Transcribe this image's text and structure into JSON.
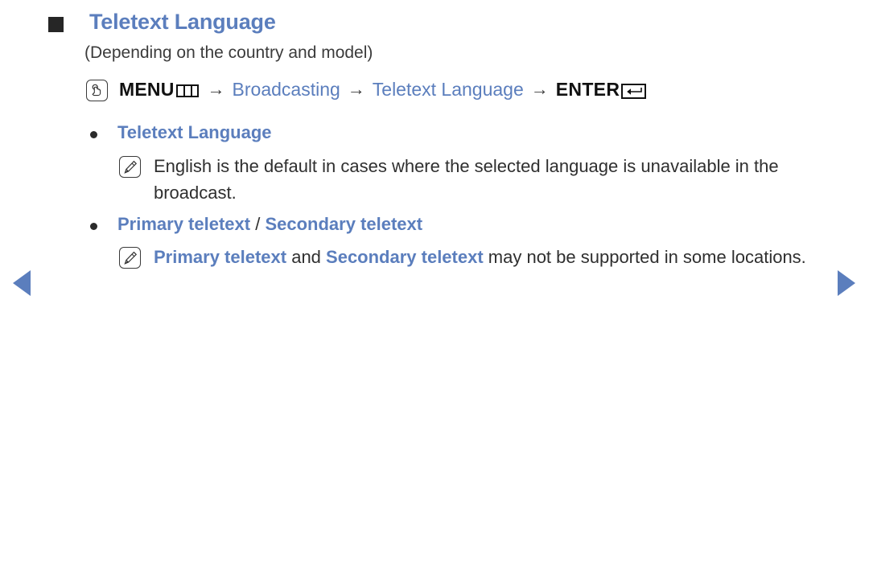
{
  "colors": {
    "accent_blue": "#5b7ebd",
    "body_text": "#2f2f2f",
    "heading_bullet": "#262626",
    "background": "#ffffff"
  },
  "heading": {
    "bullet_icon": "filled-square-icon",
    "title": "Teletext Language",
    "subtitle": "(Depending on the country and model)"
  },
  "menu_path": {
    "remote_icon": "hand-press-icon",
    "menu_label": "MENU",
    "menu_glyph_icon": "menu-three-bar-glyph-icon",
    "arrow": "→",
    "steps": [
      "Broadcasting",
      "Teletext Language"
    ],
    "enter_label": "ENTER",
    "enter_glyph_icon": "enter-return-glyph-icon"
  },
  "items": [
    {
      "bullet_icon": "bullet-dot-icon",
      "label": "Teletext Language",
      "label_parts": [
        {
          "text": "Teletext Language",
          "style": "blue-bold"
        }
      ],
      "note": {
        "icon": "note-pencil-icon",
        "parts": [
          {
            "text": "English is the default in cases where the selected language is unavailable in the broadcast.",
            "style": "plain"
          }
        ]
      }
    },
    {
      "bullet_icon": "bullet-dot-icon",
      "label": "Primary teletext / Secondary teletext",
      "label_parts": [
        {
          "text": "Primary teletext",
          "style": "blue-bold"
        },
        {
          "text": " / ",
          "style": "dark-plain"
        },
        {
          "text": "Secondary teletext",
          "style": "blue-bold"
        }
      ],
      "note": {
        "icon": "note-pencil-icon",
        "parts": [
          {
            "text": "Primary teletext",
            "style": "blue-bold"
          },
          {
            "text": " and ",
            "style": "plain"
          },
          {
            "text": "Secondary teletext",
            "style": "blue-bold"
          },
          {
            "text": " may not be supported in some locations.",
            "style": "plain"
          }
        ]
      }
    }
  ],
  "navigation": {
    "prev_icon": "triangle-left-icon",
    "next_icon": "triangle-right-icon",
    "prev_label": "",
    "next_label": ""
  }
}
